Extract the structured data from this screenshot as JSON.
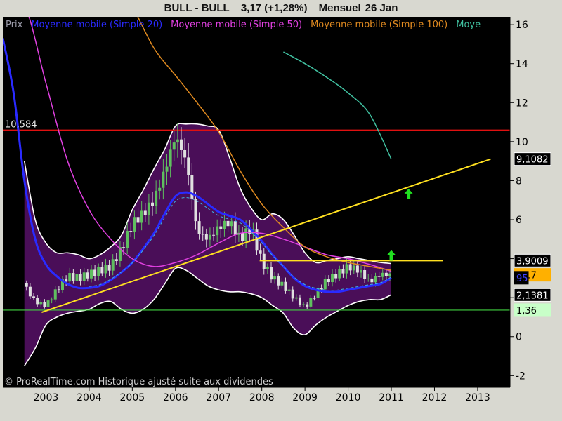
{
  "header": {
    "instrument": "BULL - BULL",
    "quote": "3,17 (+1,28%)",
    "period": "Mensuel",
    "date": "26 Jan"
  },
  "legend": [
    {
      "label": "Prix",
      "color": "#9a9aa8"
    },
    {
      "label": "Moyenne mobile (Simple 20)",
      "color": "#2a2aff"
    },
    {
      "label": "Moyenne mobile (Simple 50)",
      "color": "#e040e0"
    },
    {
      "label": "Moyenne mobile (Simple 100)",
      "color": "#e08a20"
    },
    {
      "label": "Moye",
      "color": "#40c0a0"
    }
  ],
  "footer": "© ProRealTime.com Historique ajusté suite aux dividendes",
  "price_tags": [
    {
      "text": "9,1082",
      "value": 9.1082,
      "bg": "#000000",
      "fg": "#ffffff",
      "border": "#ffffff"
    },
    {
      "text": "3,9009",
      "value": 3.9009,
      "bg": "#000000",
      "fg": "#ffffff",
      "border": "#ffffff"
    },
    {
      "text": "3,17",
      "value": 3.17,
      "bg": "#ffb000",
      "fg": "#000000",
      "border": "#ffb000"
    },
    {
      "text": "95",
      "value": 3.02,
      "bg": "#000000",
      "fg": "#4040ff",
      "border": "#000000"
    },
    {
      "text": "2,1381",
      "value": 2.1381,
      "bg": "#000000",
      "fg": "#ffffff",
      "border": "#ffffff"
    },
    {
      "text": "1,36",
      "value": 1.36,
      "bg": "#c8ffc8",
      "fg": "#000000",
      "border": "#c8ffc8"
    }
  ],
  "level_label": "10,584",
  "chart_data": {
    "type": "candlestick",
    "title": "BULL - BULL 3,17 (+1,28%) Mensuel 26 Jan",
    "x_ticks": [
      "2003",
      "2004",
      "2005",
      "2006",
      "2007",
      "2008",
      "2009",
      "2010",
      "2011",
      "2012",
      "2013"
    ],
    "y_ticks": [
      -2,
      0,
      2,
      4,
      6,
      8,
      10,
      12,
      14,
      16
    ],
    "xlim": [
      2002.0,
      2013.75
    ],
    "ylim": [
      -2.6,
      16.4
    ],
    "grid": false,
    "legend_position": "top-left",
    "colors": {
      "plot_bg": "#000000",
      "band_fill": "#4a0e58",
      "band_edge": "#ffffff",
      "up": "#5fbf5f",
      "down": "#e0e0e0",
      "resistance": "#e01010",
      "support": "#40d040",
      "trend": "#ffe020"
    },
    "horizontal_lines": [
      {
        "name": "resistance",
        "y": 10.584,
        "color": "#e01010"
      },
      {
        "name": "support",
        "y": 1.36,
        "color": "#40d040"
      }
    ],
    "trend_lines": [
      {
        "x0": 2002.9,
        "y0": 1.25,
        "x1": 2013.3,
        "y1": 9.1082,
        "color": "#ffe020"
      },
      {
        "x0": 2007.95,
        "y0": 3.9009,
        "x1": 2012.2,
        "y1": 3.9009,
        "color": "#ffe020"
      }
    ],
    "arrows": [
      {
        "x": 2011.4,
        "y": 7.3,
        "color": "#20e020"
      },
      {
        "x": 2011.0,
        "y": 4.15,
        "color": "#20e020"
      }
    ],
    "price": {
      "x": [
        2002.0,
        2002.25,
        2002.5,
        2002.75,
        2003.0,
        2003.25,
        2003.5,
        2003.75,
        2004.0,
        2004.25,
        2004.5,
        2004.75,
        2005.0,
        2005.25,
        2005.5,
        2005.75,
        2006.0,
        2006.25,
        2006.5,
        2006.75,
        2007.0,
        2007.25,
        2007.5,
        2007.75,
        2008.0,
        2008.25,
        2008.5,
        2008.75,
        2009.0,
        2009.25,
        2009.5,
        2009.75,
        2010.0,
        2010.25,
        2010.5,
        2010.75,
        2011.0
      ],
      "close": [
        4.6,
        3.6,
        2.6,
        1.8,
        1.6,
        2.4,
        3.1,
        3.0,
        3.2,
        3.4,
        3.6,
        4.5,
        5.8,
        6.3,
        7.0,
        8.5,
        10.3,
        9.0,
        5.4,
        5.0,
        5.6,
        5.9,
        5.0,
        5.6,
        3.8,
        3.0,
        2.6,
        2.0,
        1.5,
        2.2,
        2.9,
        3.2,
        3.6,
        3.4,
        2.8,
        3.2,
        3.17
      ]
    },
    "bollinger_upper": {
      "x": [
        2002.5,
        2002.75,
        2003.0,
        2003.25,
        2003.5,
        2003.75,
        2004.0,
        2004.25,
        2004.5,
        2004.75,
        2005.0,
        2005.25,
        2005.5,
        2005.75,
        2006.0,
        2006.25,
        2006.5,
        2006.75,
        2007.0,
        2007.25,
        2007.5,
        2007.75,
        2008.0,
        2008.25,
        2008.5,
        2008.75,
        2009.0,
        2009.25,
        2009.5,
        2009.75,
        2010.0,
        2010.25,
        2010.5,
        2010.75,
        2011.0
      ],
      "values": [
        9.0,
        6.0,
        4.8,
        4.3,
        4.3,
        4.2,
        4.0,
        4.2,
        4.6,
        5.2,
        6.5,
        7.5,
        8.6,
        9.6,
        10.8,
        10.9,
        10.9,
        10.8,
        10.6,
        9.2,
        7.6,
        6.6,
        6.0,
        6.3,
        6.0,
        5.2,
        4.3,
        3.8,
        3.9,
        4.0,
        4.1,
        4.0,
        3.9,
        3.8,
        3.75
      ]
    },
    "bollinger_lower": {
      "x": [
        2002.5,
        2002.75,
        2003.0,
        2003.25,
        2003.5,
        2003.75,
        2004.0,
        2004.25,
        2004.5,
        2004.75,
        2005.0,
        2005.25,
        2005.5,
        2005.75,
        2006.0,
        2006.25,
        2006.5,
        2006.75,
        2007.0,
        2007.25,
        2007.5,
        2007.75,
        2008.0,
        2008.25,
        2008.5,
        2008.75,
        2009.0,
        2009.25,
        2009.5,
        2009.75,
        2010.0,
        2010.25,
        2010.5,
        2010.75,
        2011.0
      ],
      "values": [
        -1.5,
        -0.6,
        0.6,
        1.0,
        1.2,
        1.3,
        1.4,
        1.7,
        1.8,
        1.4,
        1.2,
        1.4,
        1.9,
        2.7,
        3.5,
        3.4,
        3.0,
        2.6,
        2.4,
        2.3,
        2.3,
        2.2,
        2.0,
        1.6,
        1.2,
        0.4,
        0.1,
        0.6,
        1.0,
        1.3,
        1.6,
        1.8,
        1.9,
        1.9,
        2.15
      ]
    },
    "series": [
      {
        "name": "Moyenne mobile (Simple 20)",
        "color": "#2a2aff",
        "x": [
          2002.0,
          2002.25,
          2002.5,
          2002.75,
          2003.0,
          2003.25,
          2003.5,
          2003.75,
          2004.0,
          2004.25,
          2004.5,
          2004.75,
          2005.0,
          2005.25,
          2005.5,
          2005.75,
          2006.0,
          2006.25,
          2006.5,
          2006.75,
          2007.0,
          2007.25,
          2007.5,
          2007.75,
          2008.0,
          2008.25,
          2008.5,
          2008.75,
          2009.0,
          2009.25,
          2009.5,
          2009.75,
          2010.0,
          2010.25,
          2010.5,
          2010.75,
          2011.0
        ],
        "values": [
          15.3,
          12.5,
          8.0,
          5.0,
          3.7,
          3.1,
          2.7,
          2.5,
          2.5,
          2.6,
          2.9,
          3.3,
          3.8,
          4.5,
          5.3,
          6.3,
          7.2,
          7.4,
          7.2,
          6.8,
          6.4,
          6.2,
          6.0,
          5.5,
          4.9,
          4.2,
          3.6,
          3.0,
          2.6,
          2.4,
          2.3,
          2.3,
          2.4,
          2.5,
          2.6,
          2.7,
          3.02
        ]
      },
      {
        "name": "Moyenne mobile (Simple 50)",
        "color": "#e040e0",
        "x": [
          2002.0,
          2002.5,
          2003.0,
          2003.5,
          2004.0,
          2004.5,
          2005.0,
          2005.5,
          2006.0,
          2006.5,
          2007.0,
          2007.5,
          2008.0,
          2008.5,
          2009.0,
          2009.5,
          2010.0,
          2010.5,
          2011.0
        ],
        "values": [
          17.0,
          17.0,
          13.0,
          9.0,
          6.5,
          5.0,
          4.0,
          3.6,
          3.8,
          4.2,
          4.8,
          5.3,
          5.3,
          5.0,
          4.6,
          4.2,
          4.0,
          3.7,
          3.35
        ]
      },
      {
        "name": "Moyenne mobile (Simple 100)",
        "color": "#e08a20",
        "x": [
          2005.0,
          2005.5,
          2006.0,
          2006.5,
          2007.0,
          2007.5,
          2008.0,
          2008.5,
          2009.0,
          2009.5,
          2010.0,
          2010.5,
          2011.0
        ],
        "values": [
          17.0,
          14.8,
          13.4,
          12.0,
          10.5,
          8.5,
          6.8,
          5.6,
          4.6,
          4.1,
          3.8,
          3.6,
          3.4
        ]
      },
      {
        "name": "Moye",
        "color": "#40c0a0",
        "x": [
          2008.5,
          2009.0,
          2009.5,
          2010.0,
          2010.5,
          2011.0
        ],
        "values": [
          14.6,
          14.0,
          13.3,
          12.5,
          11.4,
          9.1
        ]
      }
    ]
  }
}
